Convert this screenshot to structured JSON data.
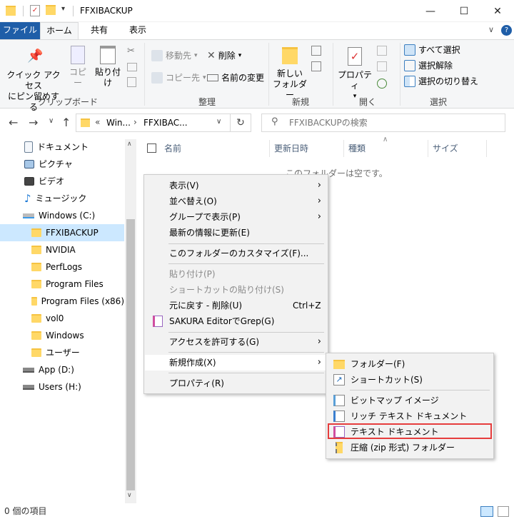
{
  "window": {
    "title": "FFXIBACKUP",
    "minimize": "—",
    "maximize": "☐",
    "close": "✕"
  },
  "tabs": [
    {
      "label": "ファイル"
    },
    {
      "label": "ホーム"
    },
    {
      "label": "共有"
    },
    {
      "label": "表示"
    }
  ],
  "ribbon": {
    "pin_label_1": "クイック アクセス",
    "pin_label_2": "にピン留めする",
    "copy": "コピー",
    "paste": "貼り付け",
    "clipboard_group": "クリップボード",
    "move_to": "移動先",
    "copy_to": "コピー先",
    "delete": "削除",
    "rename": "名前の変更",
    "organize_group": "整理",
    "new_folder_1": "新しい",
    "new_folder_2": "フォルダー",
    "new_group": "新規",
    "properties": "プロパティ",
    "open_group": "開く",
    "select_all": "すべて選択",
    "select_none": "選択解除",
    "invert_selection": "選択の切り替え",
    "select_group": "選択"
  },
  "address": {
    "prefix": "«",
    "seg1": "Win...",
    "seg2": "FFXIBAC...",
    "search_placeholder": "FFXIBACKUPの検索"
  },
  "nav": [
    {
      "label": "ドキュメント"
    },
    {
      "label": "ピクチャ"
    },
    {
      "label": "ビデオ"
    },
    {
      "label": "ミュージック"
    },
    {
      "label": "Windows (C:)"
    },
    {
      "label": "FFXIBACKUP"
    },
    {
      "label": "NVIDIA"
    },
    {
      "label": "PerfLogs"
    },
    {
      "label": "Program Files"
    },
    {
      "label": "Program Files (x86)"
    },
    {
      "label": "vol0"
    },
    {
      "label": "Windows"
    },
    {
      "label": "ユーザー"
    },
    {
      "label": "App (D:)"
    },
    {
      "label": "Users (H:)"
    }
  ],
  "columns": {
    "name": "名前",
    "date": "更新日時",
    "type": "種類",
    "size": "サイズ"
  },
  "empty_text": "このフォルダーは空です。",
  "context_menu": {
    "view": "表示(V)",
    "sort": "並べ替え(O)",
    "group": "グループで表示(P)",
    "refresh": "最新の情報に更新(E)",
    "customize": "このフォルダーのカスタマイズ(F)...",
    "paste": "貼り付け(P)",
    "paste_shortcut": "ショートカットの貼り付け(S)",
    "undo": "元に戻す - 削除(U)",
    "undo_shortcut": "Ctrl+Z",
    "grep": "SAKURA EditorでGrep(G)",
    "access": "アクセスを許可する(G)",
    "new": "新規作成(X)",
    "properties": "プロパティ(R)"
  },
  "submenu": {
    "folder": "フォルダー(F)",
    "shortcut": "ショートカット(S)",
    "bitmap": "ビットマップ イメージ",
    "rtf": "リッチ テキスト ドキュメント",
    "text": "テキスト ドキュメント",
    "zip": "圧縮 (zip 形式) フォルダー"
  },
  "status": "0 個の項目",
  "colors": {
    "file_tab": "#1f5ea8",
    "selection": "#cce8ff",
    "highlight_box": "#e63d3d"
  }
}
